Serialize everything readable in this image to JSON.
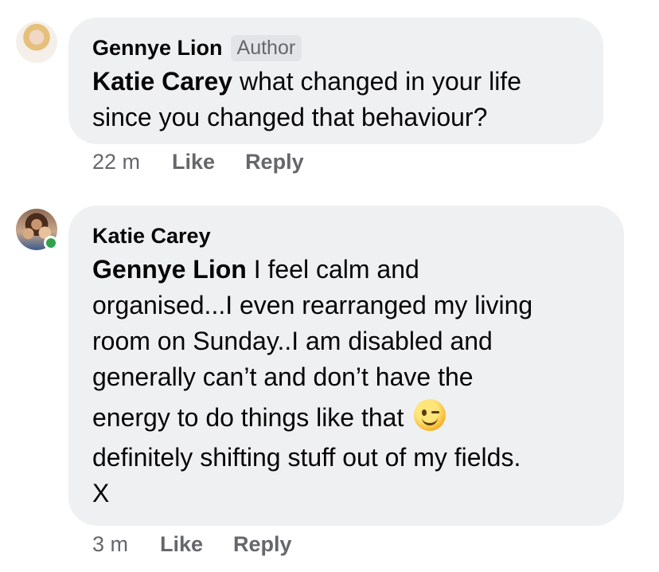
{
  "comments": [
    {
      "author": "Gennye Lion",
      "badge": "Author",
      "mention": "Katie Carey",
      "lines": [
        " what changed in your life",
        "since you changed that behaviour?"
      ],
      "time": "22 m",
      "like": "Like",
      "reply": "Reply",
      "avatar_icon": "profile-photo"
    },
    {
      "author": "Katie Carey",
      "mention": "Gennye Lion",
      "lines": [
        " I feel calm and",
        "organised...I even rearranged my living",
        "room on Sunday..I am disabled and",
        "generally can’t and don’t have the",
        "energy to do things like that",
        "definitely shifting stuff out of my fields.",
        "X"
      ],
      "emoji": "winking-face",
      "time": "3 m",
      "like": "Like",
      "reply": "Reply",
      "avatar_icon": "profile-photo",
      "online": true
    }
  ],
  "colors": {
    "bubble": "#eff0f2",
    "text": "#050505",
    "meta": "#65676b",
    "online": "#31a24c"
  }
}
